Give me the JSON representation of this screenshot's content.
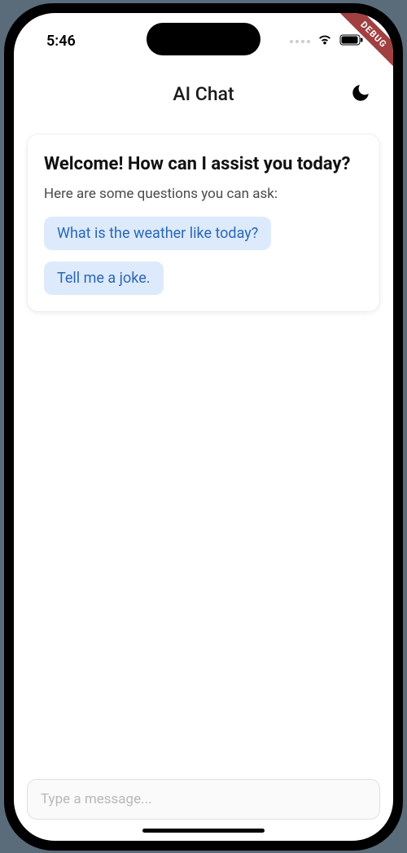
{
  "status": {
    "time": "5:46"
  },
  "debug": {
    "label": "DEBUG"
  },
  "header": {
    "title": "AI Chat"
  },
  "welcome": {
    "title": "Welcome! How can I assist you today?",
    "subtitle": "Here are some questions you can ask:",
    "suggestions": [
      "What is the weather like today?",
      "Tell me a joke."
    ]
  },
  "input": {
    "placeholder": "Type a message..."
  }
}
